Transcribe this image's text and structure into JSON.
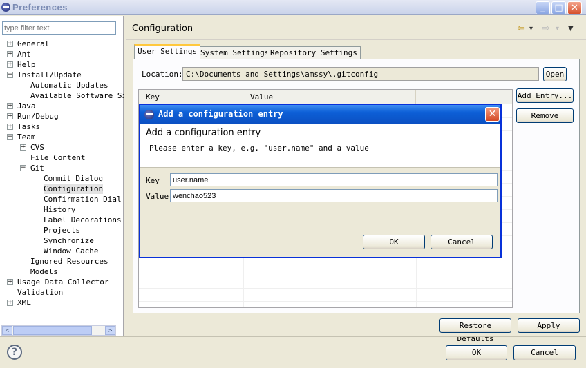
{
  "window": {
    "title": "Preferences",
    "minimize_glyph": "_",
    "maximize_glyph": "□",
    "close_glyph": "✕"
  },
  "sidebar": {
    "filter_placeholder": "type filter text",
    "tree": [
      {
        "label": "General",
        "level": 0,
        "expander": "+"
      },
      {
        "label": "Ant",
        "level": 0,
        "expander": "+"
      },
      {
        "label": "Help",
        "level": 0,
        "expander": "+"
      },
      {
        "label": "Install/Update",
        "level": 0,
        "expander": "−"
      },
      {
        "label": "Automatic Updates",
        "level": 1,
        "expander": ""
      },
      {
        "label": "Available Software Si",
        "level": 1,
        "expander": ""
      },
      {
        "label": "Java",
        "level": 0,
        "expander": "+"
      },
      {
        "label": "Run/Debug",
        "level": 0,
        "expander": "+"
      },
      {
        "label": "Tasks",
        "level": 0,
        "expander": "+"
      },
      {
        "label": "Team",
        "level": 0,
        "expander": "−"
      },
      {
        "label": "CVS",
        "level": 1,
        "expander": "+"
      },
      {
        "label": "File Content",
        "level": 1,
        "expander": ""
      },
      {
        "label": "Git",
        "level": 1,
        "expander": "−"
      },
      {
        "label": "Commit Dialog",
        "level": 2,
        "expander": ""
      },
      {
        "label": "Configuration",
        "level": 2,
        "expander": "",
        "selected": true
      },
      {
        "label": "Confirmation Dial",
        "level": 2,
        "expander": ""
      },
      {
        "label": "History",
        "level": 2,
        "expander": ""
      },
      {
        "label": "Label Decorations",
        "level": 2,
        "expander": ""
      },
      {
        "label": "Projects",
        "level": 2,
        "expander": ""
      },
      {
        "label": "Synchronize",
        "level": 2,
        "expander": ""
      },
      {
        "label": "Window Cache",
        "level": 2,
        "expander": ""
      },
      {
        "label": "Ignored Resources",
        "level": 1,
        "expander": ""
      },
      {
        "label": "Models",
        "level": 1,
        "expander": ""
      },
      {
        "label": "Usage Data Collector",
        "level": 0,
        "expander": "+"
      },
      {
        "label": "Validation",
        "level": 0,
        "expander": ""
      },
      {
        "label": "XML",
        "level": 0,
        "expander": "+"
      }
    ],
    "scroll_left": "<",
    "scroll_right": ">"
  },
  "page": {
    "title": "Configuration",
    "nav_back": "⇦",
    "nav_forward": "⇨",
    "nav_dropdown": "▾",
    "view_menu": "▼"
  },
  "tabs": [
    {
      "label": "User Settings",
      "active": true
    },
    {
      "label": "System Settings",
      "active": false
    },
    {
      "label": "Repository Settings",
      "active": false
    }
  ],
  "location": {
    "label": "Location:",
    "value": "C:\\Documents and Settings\\amssy\\.gitconfig",
    "open_label": "Open"
  },
  "table": {
    "columns": [
      "Key",
      "Value"
    ]
  },
  "buttons": {
    "add_entry": "Add Entry...",
    "remove": "Remove",
    "restore_defaults": "Restore Defaults",
    "apply": "Apply",
    "ok": "OK",
    "cancel": "Cancel",
    "help": "?"
  },
  "dialog": {
    "title": "Add a configuration entry",
    "heading": "Add a configuration entry",
    "message": "Please enter a key, e.g. \"user.name\" and a value",
    "key_label": "Key",
    "key_value": "user.name",
    "value_label": "Value",
    "value_value": "wenchao523",
    "ok": "OK",
    "cancel": "Cancel",
    "close_glyph": "✕"
  }
}
